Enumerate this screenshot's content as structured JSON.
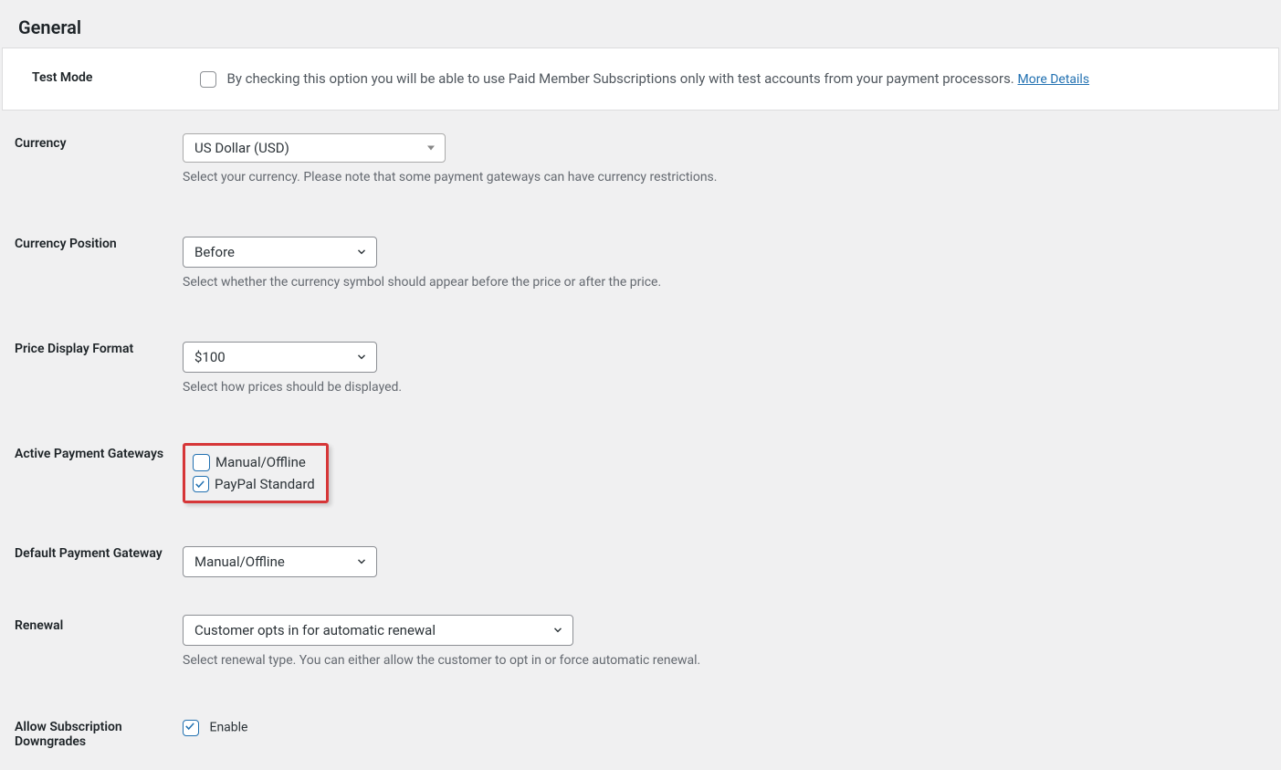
{
  "section_title": "General",
  "test_mode": {
    "label": "Test Mode",
    "description": "By checking this option you will be able to use Paid Member Subscriptions only with test accounts from your payment processors. ",
    "link_text": "More Details",
    "checked": false
  },
  "currency": {
    "label": "Currency",
    "value": "US Dollar (USD)",
    "description": "Select your currency. Please note that some payment gateways can have currency restrictions."
  },
  "currency_position": {
    "label": "Currency Position",
    "value": "Before",
    "description": "Select whether the currency symbol should appear before the price or after the price."
  },
  "price_display_format": {
    "label": "Price Display Format",
    "value": "$100",
    "description": "Select how prices should be displayed."
  },
  "active_payment_gateways": {
    "label": "Active Payment Gateways",
    "options": [
      {
        "label": "Manual/Offline",
        "checked": false
      },
      {
        "label": "PayPal Standard",
        "checked": true
      }
    ]
  },
  "default_payment_gateway": {
    "label": "Default Payment Gateway",
    "value": "Manual/Offline"
  },
  "renewal": {
    "label": "Renewal",
    "value": "Customer opts in for automatic renewal",
    "description": "Select renewal type. You can either allow the customer to opt in or force automatic renewal."
  },
  "allow_subscription_downgrades": {
    "label": "Allow Subscription Downgrades",
    "enable_label": "Enable",
    "checked": true
  }
}
